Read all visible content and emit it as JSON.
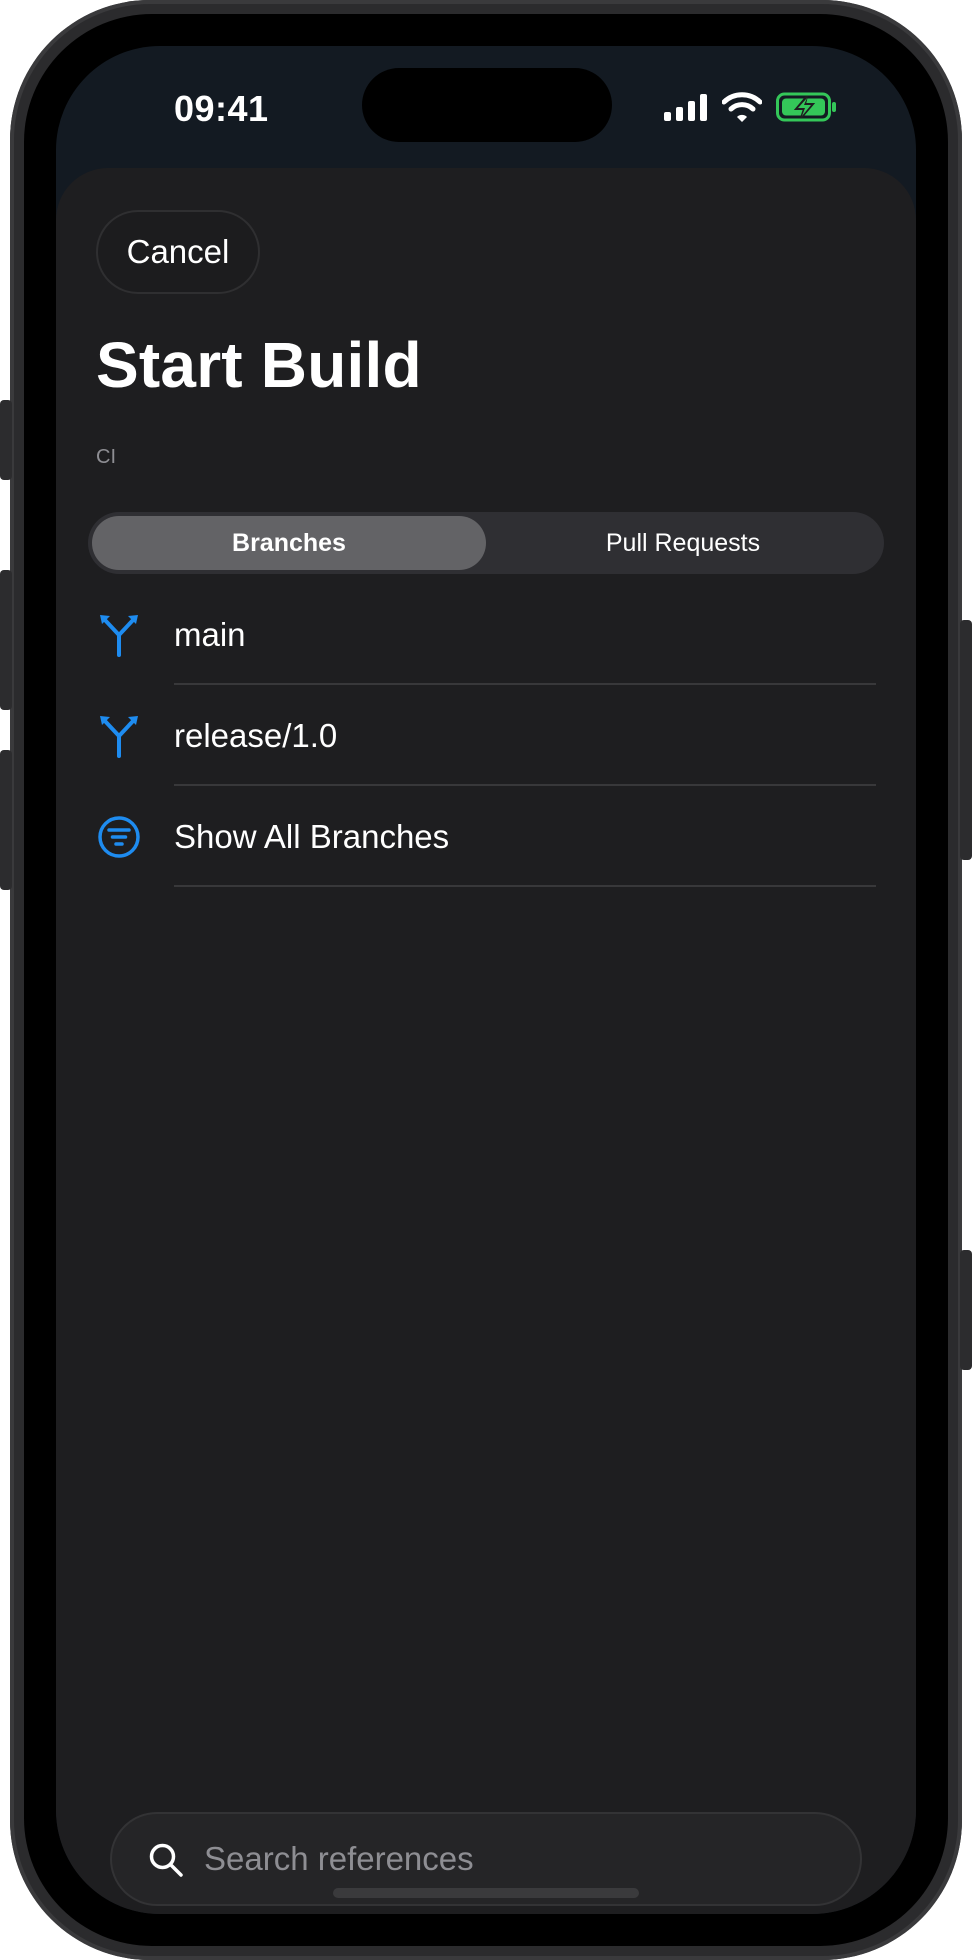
{
  "status_bar": {
    "time": "09:41",
    "icons": [
      "cellular-signal-icon",
      "wifi-icon",
      "battery-charging-icon"
    ],
    "battery_color": "#34c759"
  },
  "header": {
    "cancel_label": "Cancel",
    "title": "Start Build",
    "subtitle": "CI"
  },
  "segmented_control": {
    "segments": [
      {
        "label": "Branches",
        "selected": true
      },
      {
        "label": "Pull Requests",
        "selected": false
      }
    ]
  },
  "list": {
    "items": [
      {
        "label": "main",
        "icon": "branch-icon"
      },
      {
        "label": "release/1.0",
        "icon": "branch-icon"
      },
      {
        "label": "Show All Branches",
        "icon": "filter-icon"
      }
    ]
  },
  "search": {
    "placeholder": "Search references",
    "value": ""
  },
  "colors": {
    "accent": "#1e8cf0",
    "sheet_background": "#1e1e20",
    "segment_selected": "#636366"
  }
}
